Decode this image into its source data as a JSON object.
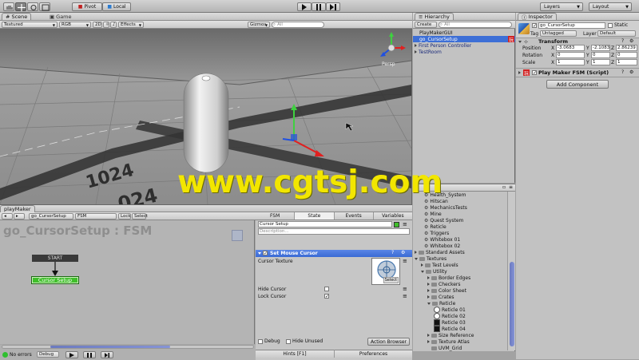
{
  "toolbar": {
    "pivot_label": "Pivot",
    "local_label": "Local",
    "layers_label": "Layers",
    "layout_label": "Layout"
  },
  "scene": {
    "tab_scene": "Scene",
    "tab_game": "Game",
    "shading_mode": "Textured",
    "render_mode": "RGB",
    "mode_2d": "2D",
    "effects_label": "Effects",
    "gizmos_label": "Gizmos",
    "search_placeholder": "All",
    "persp_label": "Persp",
    "floor_number_a": "1024",
    "floor_number_b": "024"
  },
  "watermark": "www.cgtsj.com",
  "hierarchy": {
    "tab_label": "Hierarchy",
    "create_label": "Create",
    "search_placeholder": "All",
    "items": [
      {
        "label": "PlayMakerGUI",
        "indent": 0,
        "selected": false,
        "arrow": ""
      },
      {
        "label": "go_CursorSetup",
        "indent": 0,
        "selected": true,
        "arrow": ""
      },
      {
        "label": "First Person Controller",
        "indent": 0,
        "selected": false,
        "arrow": "right"
      },
      {
        "label": "TestRoom",
        "indent": 0,
        "selected": false,
        "arrow": "right"
      }
    ],
    "badge": "玩"
  },
  "inspector": {
    "tab_label": "Inspector",
    "object_name": "go_CursorSetup",
    "static_label": "Static",
    "tag_label": "Tag",
    "tag_value": "Untagged",
    "layer_label": "Layer",
    "layer_value": "Default",
    "transform_label": "Transform",
    "position_label": "Position",
    "rotation_label": "Rotation",
    "scale_label": "Scale",
    "position": {
      "x": "-3.0683",
      "y": "-2.1083",
      "z": "2.86239"
    },
    "rotation": {
      "x": "0",
      "y": "0",
      "z": "0"
    },
    "scale": {
      "x": "1",
      "y": "1",
      "z": "1"
    },
    "script_label": "Play Maker FSM (Script)",
    "add_component_label": "Add Component",
    "badge": "玩"
  },
  "playmaker": {
    "tab_label": "playMaker",
    "object_dropdown": "go_CursorSetup",
    "fsm_dropdown": "FSM",
    "lock_label": "Lock",
    "select_label": "Select",
    "graph_title": "go_CursorSetup : FSM",
    "start_node": "START",
    "state_node": "Cursor Setup",
    "status_errors": "No errors",
    "debug_label": "Debug",
    "tabs": {
      "fsm": "FSM",
      "state": "State",
      "events": "Events",
      "variables": "Variables"
    },
    "state_name": "Cursor Setup",
    "description_placeholder": "Description...",
    "action_title": "Set Mouse Cursor",
    "cursor_texture_label": "Cursor Texture",
    "texture_select_label": "Select",
    "hide_cursor_label": "Hide Cursor",
    "lock_cursor_label": "Lock Cursor",
    "hide_cursor_checked": false,
    "lock_cursor_checked": true,
    "debug_check_label": "Debug",
    "hide_unused_label": "Hide Unused",
    "action_browser_label": "Action Browser",
    "hints_label": "Hints [F1]",
    "preferences_label": "Preferences"
  },
  "project": {
    "items": [
      {
        "label": "Health_System",
        "type": "script",
        "indent": 2
      },
      {
        "label": "Hitscan",
        "type": "script",
        "indent": 2
      },
      {
        "label": "MechanicsTests",
        "type": "script",
        "indent": 2
      },
      {
        "label": "Mine",
        "type": "script",
        "indent": 2
      },
      {
        "label": "Quest System",
        "type": "script",
        "indent": 2
      },
      {
        "label": "Reticle",
        "type": "script",
        "indent": 2
      },
      {
        "label": "Triggers",
        "type": "script",
        "indent": 2
      },
      {
        "label": "Whitebox 01",
        "type": "script",
        "indent": 2
      },
      {
        "label": "Whitebox 02",
        "type": "script",
        "indent": 2
      },
      {
        "label": "Standard Assets",
        "type": "folder",
        "indent": 0,
        "arrow": "right"
      },
      {
        "label": "Textures",
        "type": "folder",
        "indent": 0,
        "arrow": "down"
      },
      {
        "label": "Test Levels",
        "type": "folder",
        "indent": 1,
        "arrow": "right"
      },
      {
        "label": "Utility",
        "type": "folder",
        "indent": 1,
        "arrow": "down"
      },
      {
        "label": "Border Edges",
        "type": "folder",
        "indent": 2,
        "arrow": "right"
      },
      {
        "label": "Checkers",
        "type": "folder",
        "indent": 2,
        "arrow": "right"
      },
      {
        "label": "Color Sheet",
        "type": "folder",
        "indent": 2,
        "arrow": "right"
      },
      {
        "label": "Crates",
        "type": "folder",
        "indent": 2,
        "arrow": "right"
      },
      {
        "label": "Reticle",
        "type": "folder",
        "indent": 2,
        "arrow": "down"
      },
      {
        "label": "Reticle 01",
        "type": "tex-white",
        "indent": 3
      },
      {
        "label": "Reticle 02",
        "type": "tex-white",
        "indent": 3
      },
      {
        "label": "Reticle 03",
        "type": "tex-black",
        "indent": 3
      },
      {
        "label": "Reticle 04",
        "type": "tex-black",
        "indent": 3
      },
      {
        "label": "Size Reference",
        "type": "folder",
        "indent": 2,
        "arrow": "right"
      },
      {
        "label": "Texture Atlas",
        "type": "folder",
        "indent": 2,
        "arrow": "right"
      },
      {
        "label": "UVM_Grid",
        "type": "folder",
        "indent": 2,
        "arrow": ""
      }
    ]
  },
  "colors": {
    "selection_blue": "#3d6fd6",
    "state_green": "#3fbf2a",
    "action_header": "#3a6ad4",
    "watermark_yellow": "#f2e600"
  }
}
